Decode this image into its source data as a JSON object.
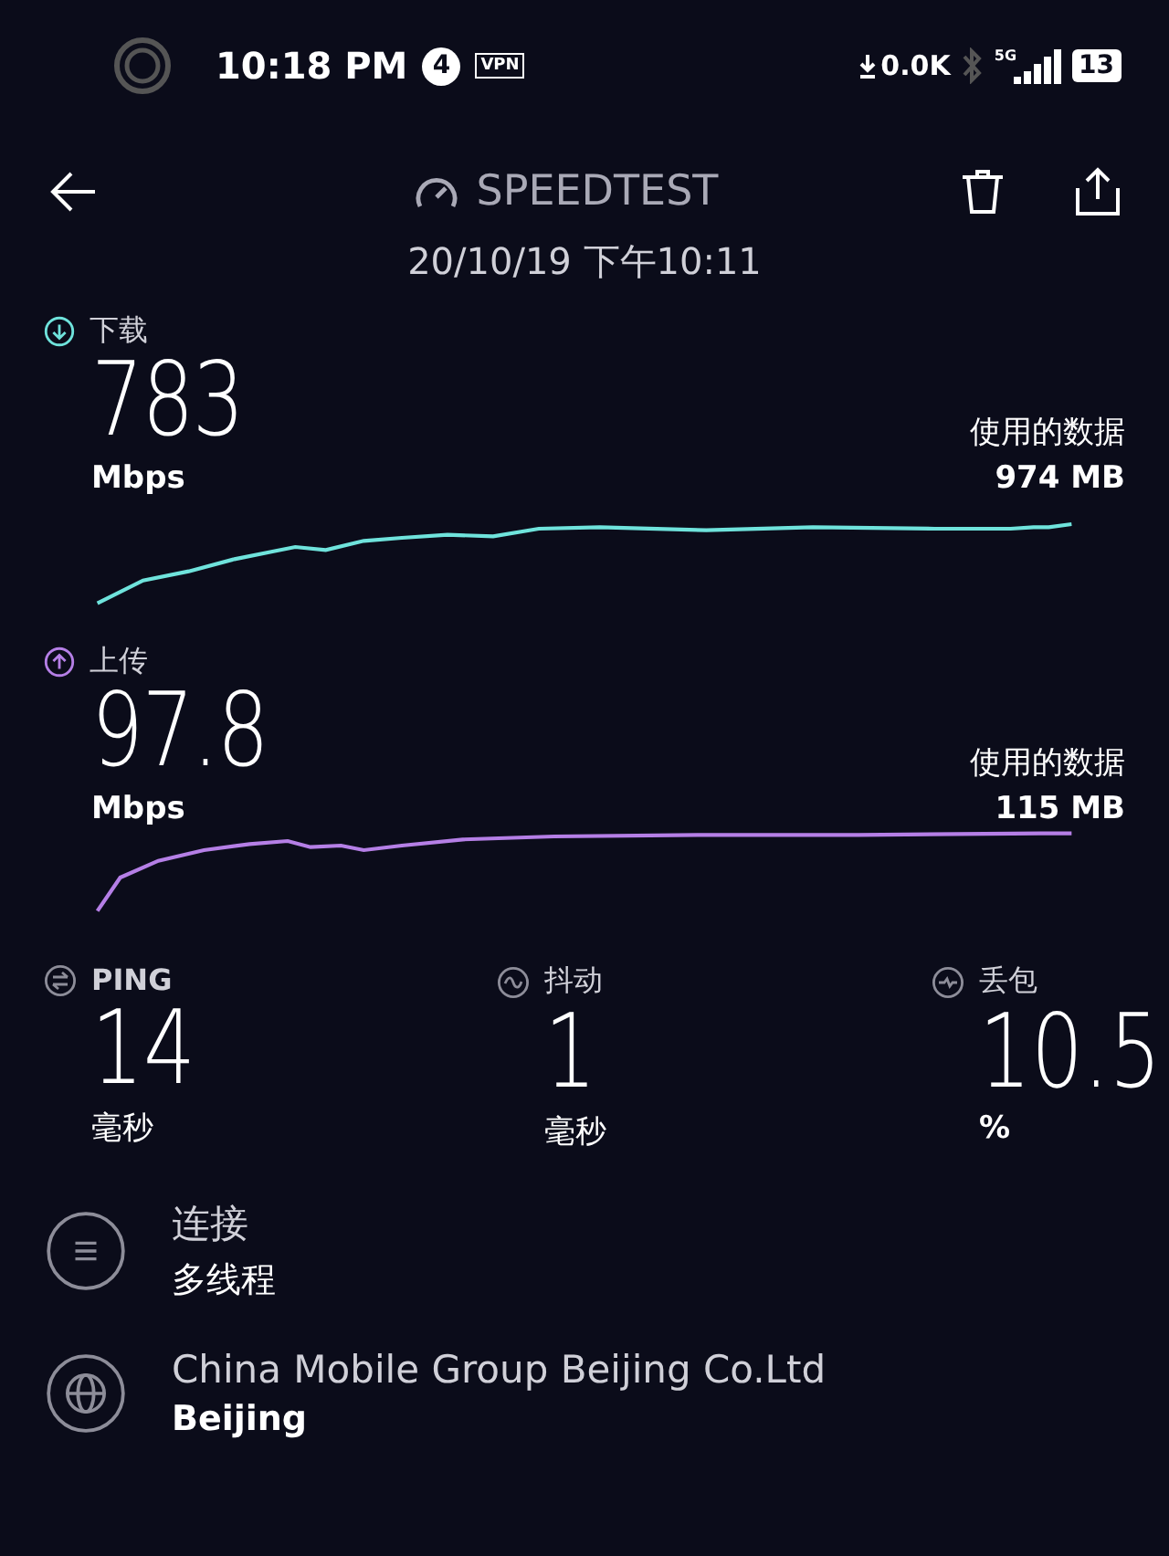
{
  "status_bar": {
    "time": "10:18 PM",
    "notification_count": "4",
    "vpn": "VPN",
    "net_speed": "0.0K",
    "network": "5G",
    "battery": "13"
  },
  "header": {
    "title": "SPEEDTEST",
    "date": "20/10/19 下午10:11"
  },
  "results": [
    {
      "kind": "download",
      "label": "下载",
      "value": "783",
      "unit": "Mbps",
      "data_label": "使用的数据",
      "data_value": "974 MB",
      "color": "#6fe3dc"
    },
    {
      "kind": "upload",
      "label": "上传",
      "value": "97.8",
      "unit": "Mbps",
      "data_label": "使用的数据",
      "data_value": "115 MB",
      "color": "#b57fe6"
    }
  ],
  "metrics": [
    {
      "kind": "ping",
      "label": "PING",
      "value": "14",
      "unit": "毫秒"
    },
    {
      "kind": "jitter",
      "label": "抖动",
      "value": "1",
      "unit": "毫秒"
    },
    {
      "kind": "loss",
      "label": "丢包",
      "value": "10.5",
      "unit": "%"
    }
  ],
  "details": [
    {
      "kind": "connection",
      "title": "连接",
      "subtitle": "多线程"
    },
    {
      "kind": "server",
      "title": "China Mobile Group Beijing Co.Ltd",
      "subtitle": "Beijing"
    }
  ]
}
